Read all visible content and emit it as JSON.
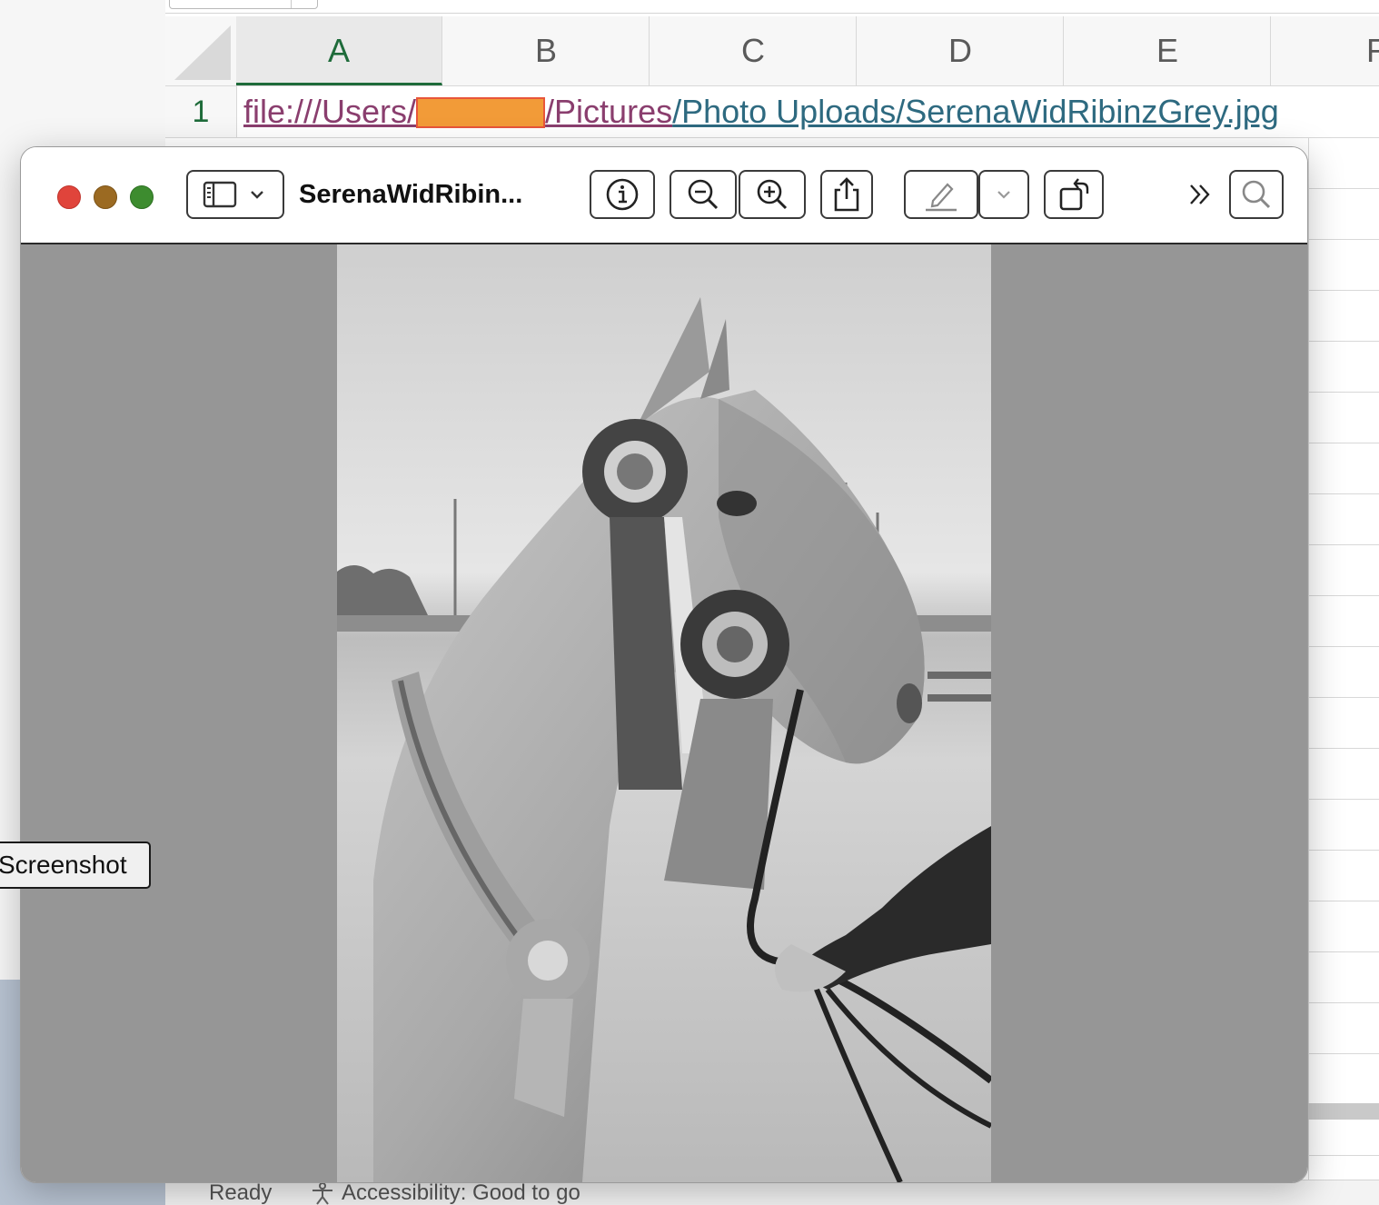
{
  "spreadsheet": {
    "columns": [
      "A",
      "B",
      "C",
      "D",
      "E",
      "F"
    ],
    "active_column": "A",
    "row_number": "1",
    "cell_a1": {
      "part_visited_1": "file:///Users/",
      "part_visited_2": "/Pictures",
      "part_link": "/Photo Uploads/SerenaWidRibinzGrey.jpg",
      "redacted_color": "#f29b38"
    },
    "status": {
      "ready": "Ready",
      "accessibility": "Accessibility: Good to go"
    }
  },
  "screenshot_button": {
    "label": "Screenshot"
  },
  "preview_window": {
    "title": "SerenaWidRibin...",
    "toolbar": {
      "sidebar_toggle": "sidebar-icon",
      "info": "info-icon",
      "zoom_out": "zoom-out-icon",
      "zoom_in": "zoom-in-icon",
      "share": "share-icon",
      "markup": "pen-icon",
      "rotate": "rotate-icon",
      "more": "double-chevron-icon",
      "search": "search-icon"
    },
    "image_description_colors": {
      "canvas_bg": "#969696"
    }
  }
}
